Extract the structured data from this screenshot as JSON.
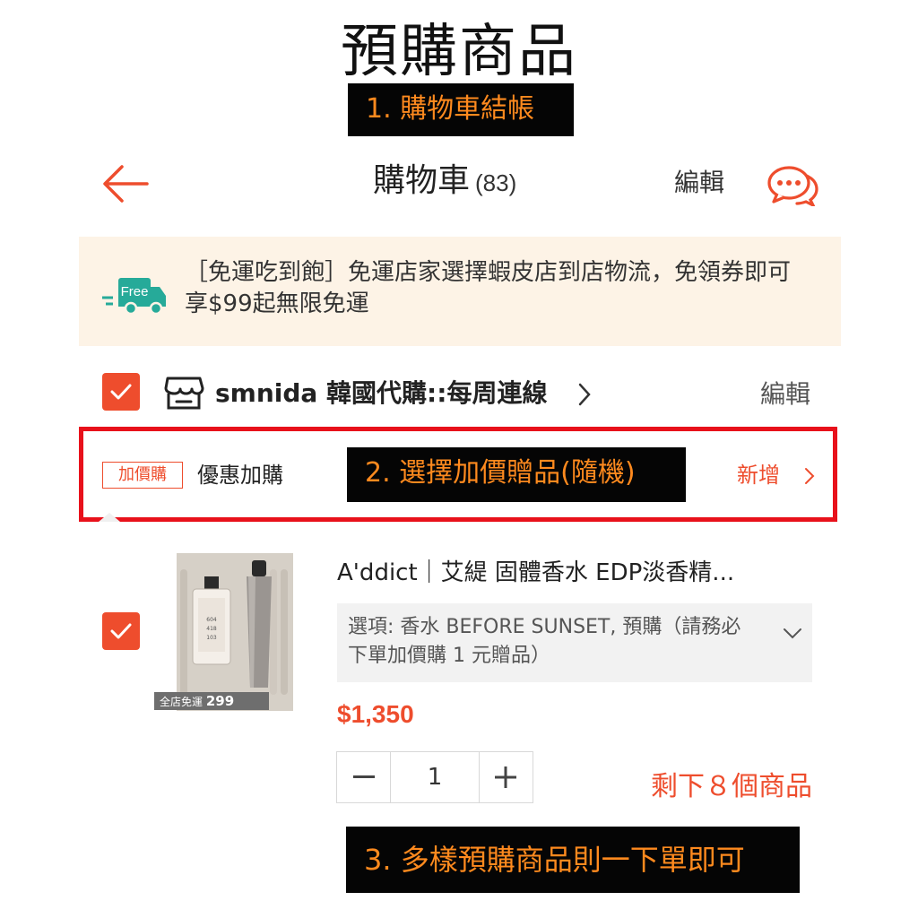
{
  "headline": "預購商品",
  "steps": {
    "step1": "1. 購物車結帳",
    "step2": "2. 選擇加價贈品(隨機)",
    "step3": "3. 多樣預購商品則一下單即可"
  },
  "header": {
    "title": "購物車",
    "count": "(83)",
    "edit_label": "編輯"
  },
  "banner": {
    "icon_text": "Free",
    "text": "［免運吃到飽］免運店家選擇蝦皮店到店物流，免領券即可享$99起無限免運"
  },
  "shop": {
    "name": "smnida 韓國代購::每周連線",
    "edit_label": "編輯"
  },
  "addon": {
    "tag": "加價購",
    "label": "優惠加購",
    "add_label": "新增"
  },
  "product": {
    "name": "A'ddict｜艾緹 固體香水 EDP淡香精...",
    "variant": "選項: 香水 BEFORE SUNSET, 預購（請務必下單加價購 1 元贈品）",
    "price": "$1,350",
    "quantity": "1",
    "stock": "剩下８個商品",
    "badge_prefix": "全店免運",
    "badge_value": "299"
  },
  "colors": {
    "accent": "#ee4d2d",
    "highlight_box": "#e8111b",
    "caption_text": "#ff8a1e",
    "banner_bg": "#fdf3e6",
    "free_icon": "#26aa99"
  },
  "icons": {
    "back": "arrow-left-icon",
    "chat": "chat-bubbles-icon",
    "truck": "free-shipping-truck-icon",
    "shop": "shop-icon",
    "check": "checkmark-icon",
    "chevron": "chevron-right-icon",
    "dropdown": "chevron-down-icon"
  }
}
